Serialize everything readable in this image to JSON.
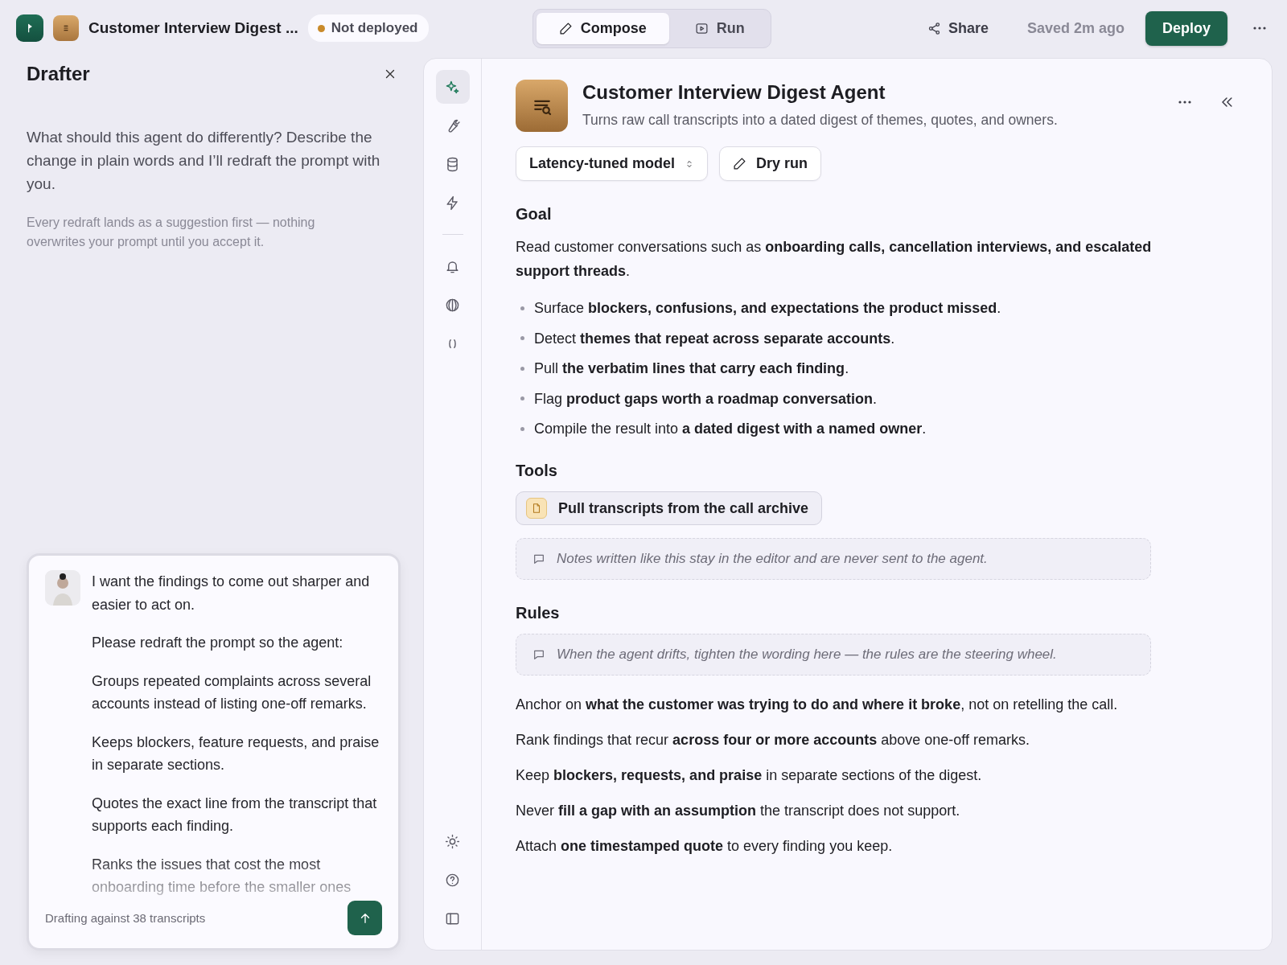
{
  "topbar": {
    "agent_name": "Customer Interview Digest ...",
    "status": {
      "label": "Not deployed",
      "color": "#c98a2b"
    },
    "tabs": [
      {
        "label": "Compose",
        "kind": "pencil",
        "selected": true
      },
      {
        "label": "Run",
        "kind": "play",
        "selected": false
      }
    ],
    "share": "Share",
    "saved": "Saved 2m ago",
    "deploy": "Deploy"
  },
  "drafter": {
    "title": "Drafter",
    "intro": "What should this agent do differently? Describe the change in plain words and I’ll redraft the prompt with you.",
    "note": "Every redraft lands as a suggestion first — nothing overwrites your prompt until you accept it.",
    "message": [
      "I want the findings to come out sharper and easier to act on.",
      "Please redraft the prompt so the agent:",
      "Groups repeated complaints across several accounts instead of listing one-off remarks.",
      "Keeps blockers, feature requests, and praise in separate sections.",
      "Quotes the exact line from the transcript that supports each finding.",
      "Ranks the issues that cost the most onboarding time before the smaller ones"
    ],
    "footer": "Drafting against 38 transcripts"
  },
  "rail": [
    {
      "kind": "sparkle",
      "selected": true
    },
    {
      "kind": "wrench",
      "selected": false
    },
    {
      "kind": "database",
      "selected": false
    },
    {
      "kind": "bolt",
      "selected": false
    },
    {
      "kind": "divider"
    },
    {
      "kind": "bell",
      "selected": false
    },
    {
      "kind": "globe",
      "selected": false
    },
    {
      "kind": "braces",
      "selected": false
    },
    {
      "kind": "spacer"
    },
    {
      "kind": "sun",
      "selected": false
    },
    {
      "kind": "help",
      "selected": false
    },
    {
      "kind": "panel",
      "selected": false
    }
  ],
  "agent": {
    "title": "Customer Interview Digest Agent",
    "description": "Turns raw call transcripts into a dated digest of themes, quotes, and owners.",
    "model": "Latency-tuned model",
    "dry_run": "Dry run"
  },
  "sections": [
    {
      "heading": "Goal",
      "blocks": [
        {
          "kind": "paragraph",
          "text": "Read customer conversations such as **onboarding calls, cancellation interviews, and escalated support threads**."
        },
        {
          "kind": "bullets",
          "items": [
            "Surface **blockers, confusions, and expectations the product missed**.",
            "Detect **themes that repeat across separate accounts**.",
            "Pull **the verbatim lines that carry each finding**.",
            "Flag **product gaps worth a roadmap conversation**.",
            "Compile the result into **a dated digest with a named owner**."
          ]
        }
      ]
    },
    {
      "heading": "Tools",
      "blocks": [
        {
          "kind": "tool",
          "text": "Pull transcripts from the call archive"
        },
        {
          "kind": "note",
          "text": "Notes written like this stay in the editor and are never sent to the agent."
        }
      ]
    },
    {
      "heading": "Rules",
      "blocks": [
        {
          "kind": "note",
          "text": "When the agent drifts, tighten the wording here — the rules are the steering wheel."
        },
        {
          "kind": "rules",
          "items": [
            "Anchor on **what the customer was trying to do and where it broke**, not on retelling the call.",
            "Rank findings that recur **across four or more accounts** above one-off remarks.",
            "Keep **blockers, requests, and praise** in separate sections of the digest.",
            "Never **fill a gap with an assumption** the transcript does not support.",
            "Attach **one timestamped quote** to every finding you keep."
          ]
        }
      ]
    }
  ]
}
